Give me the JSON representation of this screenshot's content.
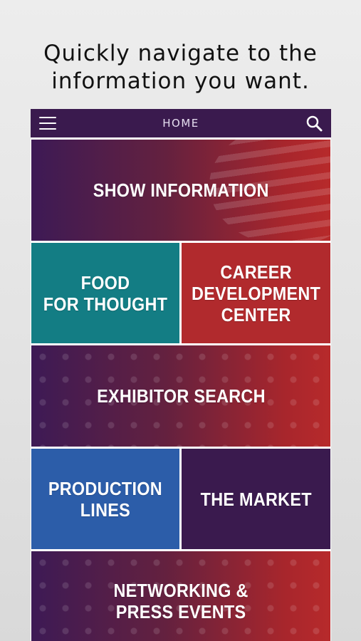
{
  "promo": {
    "headline_line1": "Quickly navigate to the",
    "headline_line2": "information you want."
  },
  "nav": {
    "title": "HOME",
    "menu_icon": "hamburger-menu-icon",
    "search_icon": "search-icon"
  },
  "tiles": {
    "show_information": "SHOW INFORMATION",
    "food_for_thought": "FOOD\nFOR THOUGHT",
    "career_development": "CAREER\nDEVELOPMENT\nCENTER",
    "exhibitor_search": "EXHIBITOR SEARCH",
    "production_lines": "PRODUCTION\nLINES",
    "the_market": "THE MARKET",
    "networking": "NETWORKING &\nPRESS EVENTS"
  },
  "colors": {
    "nav_bg": "#3a1a4e",
    "teal": "#137d84",
    "red": "#b12a2d",
    "blue": "#2c5da9",
    "purple": "#3a1a4e"
  }
}
